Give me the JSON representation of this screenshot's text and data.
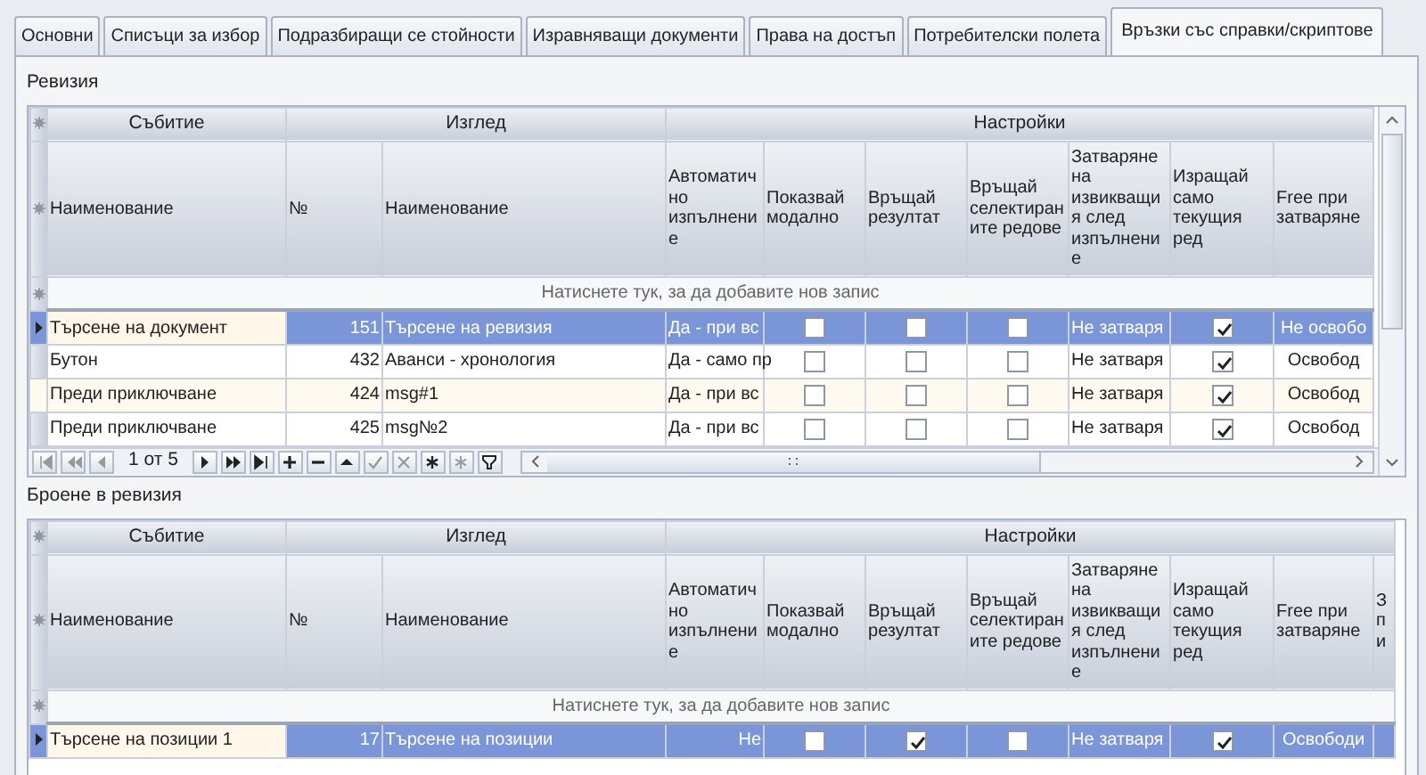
{
  "tabs": [
    {
      "label": "Основни",
      "selected": false
    },
    {
      "label": "Списъци за избор",
      "selected": false
    },
    {
      "label": "Подразбиращи се стойности",
      "selected": false
    },
    {
      "label": "Изравняващи документи",
      "selected": false
    },
    {
      "label": "Права на достъп",
      "selected": false
    },
    {
      "label": "Потребителски полета",
      "selected": false
    },
    {
      "label": "Връзки със справки/скриптове",
      "selected": true
    }
  ],
  "grids": [
    {
      "title": "Ревизия",
      "groups": [
        {
          "label": "Събитие",
          "columns": [
            {
              "label": "Наименование",
              "kind": "text"
            }
          ]
        },
        {
          "label": "Изглед",
          "columns": [
            {
              "label": "№",
              "kind": "number"
            },
            {
              "label": "Наименование",
              "kind": "text"
            }
          ]
        },
        {
          "label": "Настройки",
          "columns": [
            {
              "label": "Автоматично изпълнение",
              "kind": "text"
            },
            {
              "label": "Показвай модално",
              "kind": "check"
            },
            {
              "label": "Връщай резултат",
              "kind": "check"
            },
            {
              "label": "Връщай селектираните редове",
              "kind": "check"
            },
            {
              "label": "Затваряне на извикващия след изпълнение",
              "kind": "text"
            },
            {
              "label": "Изращай само текущия ред",
              "kind": "check"
            },
            {
              "label": "Free при затваряне",
              "kind": "center"
            }
          ]
        }
      ],
      "new_row_hint": "Натиснете тук, за да добавите нов запис",
      "rows": [
        {
          "selected": true,
          "cells": [
            "Търсене на документ",
            "151",
            "Търсене на ревизия",
            "Да - при вс",
            false,
            false,
            false,
            "Не затваря",
            true,
            "Не освобо"
          ]
        },
        {
          "selected": false,
          "cells": [
            "Бутон",
            "432",
            "Аванси - хронология",
            "Да - само пр",
            false,
            false,
            false,
            "Не затваря",
            true,
            "Освобод"
          ]
        },
        {
          "selected": false,
          "cells": [
            "Преди приключване",
            "424",
            "msg#1",
            "Да - при вс",
            false,
            false,
            false,
            "Не затваря",
            true,
            "Освобод"
          ]
        },
        {
          "selected": false,
          "cells": [
            "Преди приключване",
            "425",
            "msg№2",
            "Да - при вс",
            false,
            false,
            false,
            "Не затваря",
            true,
            "Освобод"
          ]
        }
      ],
      "navigator": {
        "position": "1 от 5"
      }
    },
    {
      "title": "Броене в ревизия",
      "groups": [
        {
          "label": "Събитие",
          "columns": [
            {
              "label": "Наименование",
              "kind": "text"
            }
          ]
        },
        {
          "label": "Изглед",
          "columns": [
            {
              "label": "№",
              "kind": "number"
            },
            {
              "label": "Наименование",
              "kind": "text"
            }
          ]
        },
        {
          "label": "Настройки",
          "columns": [
            {
              "label": "Автоматично изпълнение",
              "kind": "number"
            },
            {
              "label": "Показвай модално",
              "kind": "check"
            },
            {
              "label": "Връщай резултат",
              "kind": "check"
            },
            {
              "label": "Връщай селектираните редове",
              "kind": "check"
            },
            {
              "label": "Затваряне на извикващия след изпълнение",
              "kind": "text"
            },
            {
              "label": "Изращай само текущия ред",
              "kind": "check"
            },
            {
              "label": "Free при затваряне",
              "kind": "center"
            },
            {
              "label": "З п и",
              "kind": "text"
            }
          ]
        }
      ],
      "new_row_hint": "Натиснете тук, за да добавите нов запис",
      "rows": [
        {
          "selected": true,
          "cells": [
            "Търсене на позиции 1",
            "17",
            "Търсене на позиции",
            "Не",
            false,
            true,
            false,
            "Не затваря",
            true,
            "Освободи"
          ]
        }
      ]
    }
  ]
}
